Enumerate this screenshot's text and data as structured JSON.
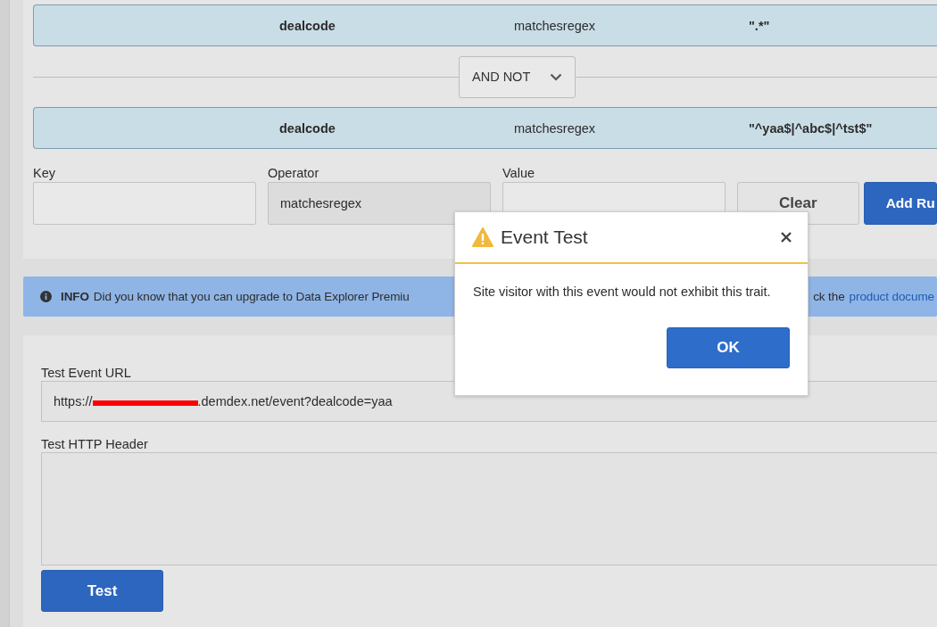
{
  "rules": [
    {
      "key": "dealcode",
      "operator": "matchesregex",
      "value": "\".*\""
    },
    {
      "key": "dealcode",
      "operator": "matchesregex",
      "value": "\"^yaa$|^abc$|^tst$\""
    }
  ],
  "conjunction": {
    "label": "AND NOT"
  },
  "rule_form": {
    "fields": [
      {
        "label": "Key",
        "kind": "text"
      },
      {
        "label": "Operator",
        "kind": "select",
        "value": "matchesregex"
      },
      {
        "label": "Value",
        "kind": "text"
      }
    ],
    "buttons": [
      {
        "label": "Clear",
        "kind": "secondary"
      },
      {
        "label": "Add Ru",
        "kind": "primary"
      }
    ]
  },
  "info": {
    "tag": "INFO",
    "text_before": "Did you know that you can upgrade to Data Explorer Premiu",
    "text_after": "ck the",
    "link": "product docume"
  },
  "test_form": {
    "url_label": "Test Event URL",
    "url_start": "https://",
    "url_redacted": true,
    "url_end": ".demdex.net/event?dealcode=yaa",
    "header_label": "Test HTTP Header",
    "button": "Test"
  },
  "dialog": {
    "title": "Event Test",
    "message": "Site visitor with this event would not exhibit this trait.",
    "button": "OK"
  }
}
